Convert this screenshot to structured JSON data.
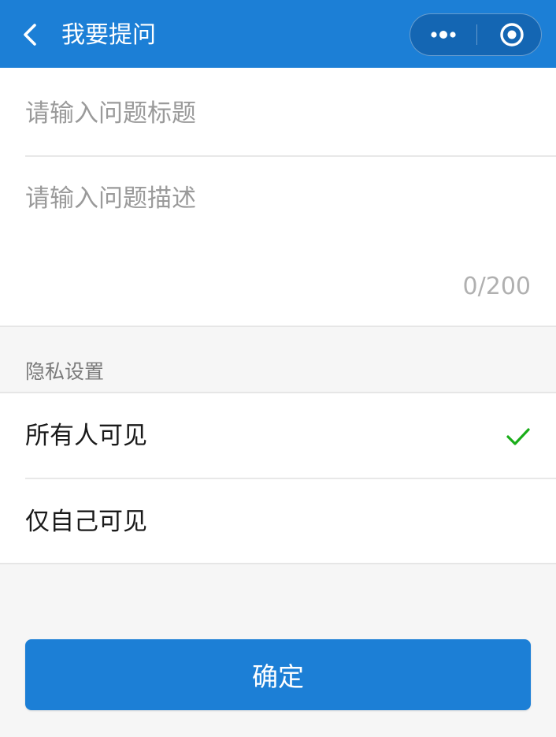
{
  "header": {
    "title": "我要提问",
    "back_icon": "back-chevron-icon",
    "more_icon": "more-dots-icon",
    "close_icon": "target-circle-icon",
    "background_color": "#1c7fd6"
  },
  "form": {
    "title_placeholder": "请输入问题标题",
    "title_value": "",
    "description_placeholder": "请输入问题描述",
    "description_value": "",
    "char_count": "0/200"
  },
  "privacy": {
    "section_label": "隐私设置",
    "options": [
      {
        "label": "所有人可见",
        "selected": true
      },
      {
        "label": "仅自己可见",
        "selected": false
      }
    ],
    "check_icon": "checkmark-icon",
    "check_color": "#1aad19"
  },
  "actions": {
    "confirm_label": "确定"
  }
}
